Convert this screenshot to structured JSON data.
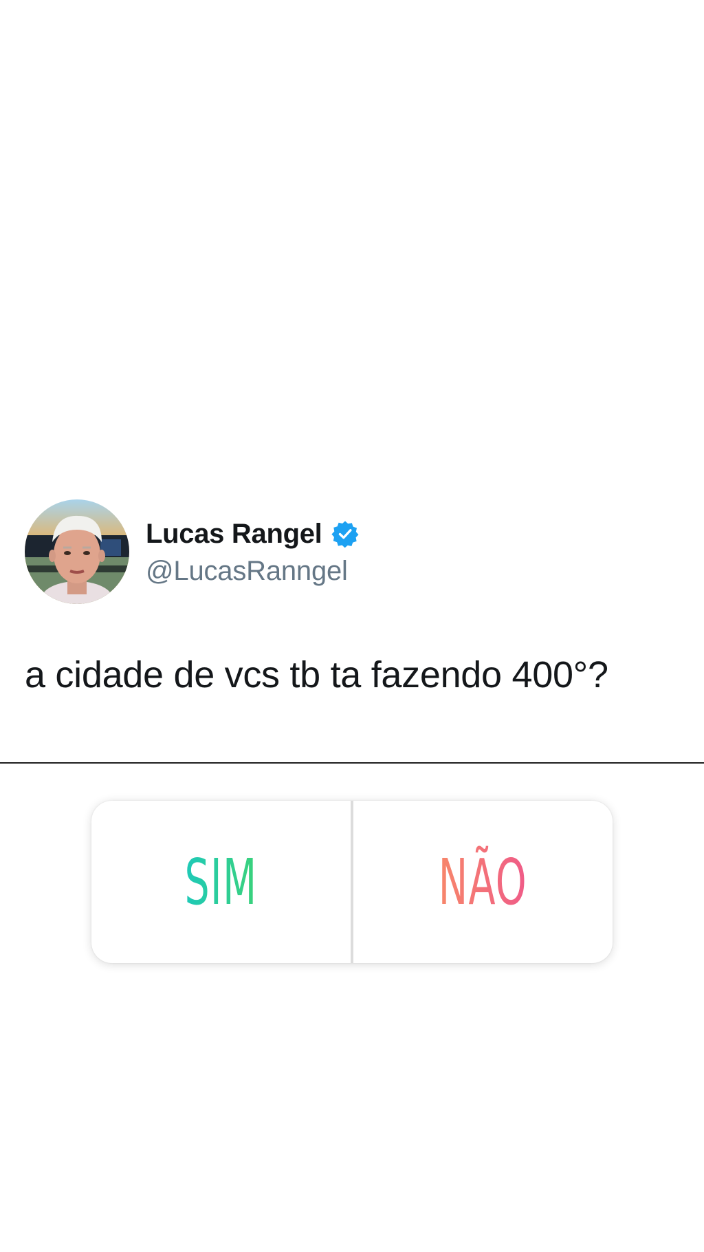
{
  "tweet": {
    "display_name": "Lucas Rangel",
    "handle": "@LucasRanngel",
    "verified": true,
    "verified_icon": "verified-badge-icon",
    "text": "a cidade de vcs tb ta fazendo 400°?"
  },
  "poll": {
    "yes_label": "SIM",
    "no_label": "NÃO"
  },
  "colors": {
    "verified_blue": "#1da1f2",
    "handle_gray": "#657786",
    "yes_gradient": [
      "#1ec9b8",
      "#3bd27a"
    ],
    "no_gradient": [
      "#f7876a",
      "#ef5b88"
    ]
  }
}
